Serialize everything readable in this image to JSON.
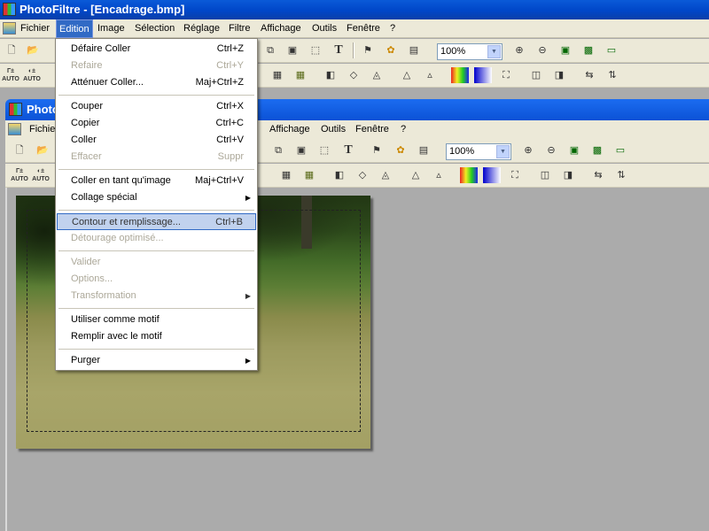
{
  "app": {
    "title": "PhotoFiltre - [Encadrage.bmp]"
  },
  "menubar": {
    "items": [
      "Fichier",
      "Edition",
      "Image",
      "Sélection",
      "Réglage",
      "Filtre",
      "Affichage",
      "Outils",
      "Fenêtre",
      "?"
    ],
    "active": "Edition"
  },
  "toolbar": {
    "zoom_value": "100%",
    "auto_label": "AUTO"
  },
  "child_window": {
    "title": "Photo",
    "menubar_items": [
      "Fichie",
      "Affichage",
      "Outils",
      "Fenêtre",
      "?"
    ]
  },
  "edition_menu": {
    "items": [
      {
        "label": "Défaire Coller",
        "shortcut": "Ctrl+Z",
        "enabled": true
      },
      {
        "label": "Refaire",
        "shortcut": "Ctrl+Y",
        "enabled": false
      },
      {
        "label": "Atténuer Coller...",
        "shortcut": "Maj+Ctrl+Z",
        "enabled": true
      },
      {
        "label": "Couper",
        "shortcut": "Ctrl+X",
        "enabled": true
      },
      {
        "label": "Copier",
        "shortcut": "Ctrl+C",
        "enabled": true
      },
      {
        "label": "Coller",
        "shortcut": "Ctrl+V",
        "enabled": true
      },
      {
        "label": "Effacer",
        "shortcut": "Suppr",
        "enabled": false
      },
      {
        "label": "Coller en tant qu'image",
        "shortcut": "Maj+Ctrl+V",
        "enabled": true
      },
      {
        "label": "Collage spécial",
        "submenu": true,
        "enabled": true
      },
      {
        "label": "Contour et remplissage...",
        "shortcut": "Ctrl+B",
        "enabled": true,
        "highlighted": true
      },
      {
        "label": "Détourage optimisé...",
        "enabled": false
      },
      {
        "label": "Valider",
        "enabled": false
      },
      {
        "label": "Options...",
        "enabled": false
      },
      {
        "label": "Transformation",
        "submenu": true,
        "enabled": false
      },
      {
        "label": "Utiliser comme motif",
        "enabled": true
      },
      {
        "label": "Remplir avec le motif",
        "enabled": true
      },
      {
        "label": "Purger",
        "submenu": true,
        "enabled": true
      }
    ]
  },
  "colors": {
    "titlebar": "#0046c8",
    "menu_highlight": "#c1d2ee",
    "menubar_active": "#316ac5",
    "workspace": "#ababab",
    "toolbar": "#ece9d8"
  }
}
